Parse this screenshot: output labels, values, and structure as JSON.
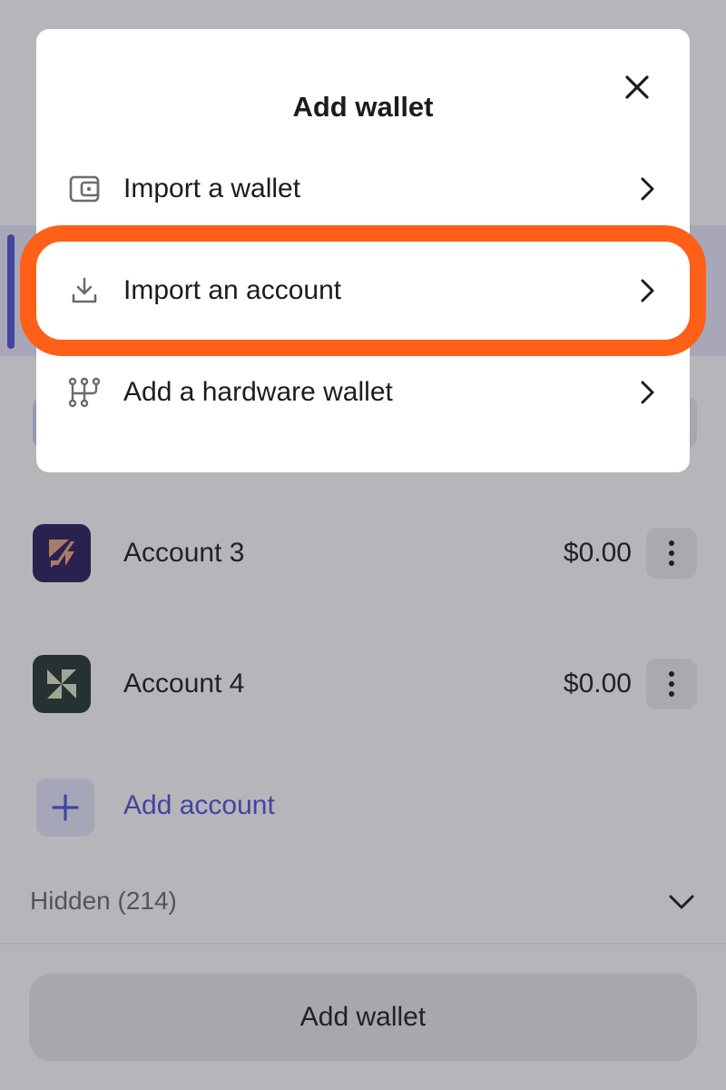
{
  "modal": {
    "title": "Add wallet",
    "close_icon": "close-icon",
    "items": [
      {
        "label": "Import a wallet",
        "icon": "wallet-icon"
      },
      {
        "label": "Import an account",
        "icon": "download-icon"
      },
      {
        "label": "Add a hardware wallet",
        "icon": "hardware-icon"
      }
    ]
  },
  "background": {
    "accounts": [
      {
        "name": "Account 3",
        "balance": "$0.00",
        "avatar_color": "#2b1f5c"
      },
      {
        "name": "Account 4",
        "balance": "$0.00",
        "avatar_color": "#23382f"
      }
    ],
    "add_account_label": "Add account",
    "hidden_label": "Hidden (214)",
    "bottom_button_label": "Add wallet"
  },
  "colors": {
    "accent": "#4f52d9",
    "highlight_ring": "#ff5f17"
  }
}
